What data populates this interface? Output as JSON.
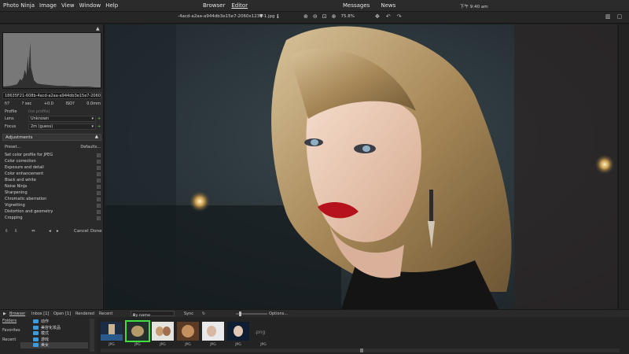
{
  "menubar": {
    "app_name": "Photo Ninja",
    "menus": [
      "Image",
      "View",
      "Window",
      "Help"
    ],
    "mode_browser": "Browser",
    "mode_editor": "Editor",
    "messages": "Messages",
    "news": "News",
    "clock": "下午 9:40 am"
  },
  "toolbar": {
    "filename": "-4acd-a2aa-a944db3e15e7-2060x1236-1.jpg",
    "zoom_pct": "75.8%"
  },
  "left": {
    "filename_full": "18635F21-608b-4acd-a2aa-a944db3e15e7-2060x...",
    "meta": {
      "aperture": "f/?",
      "shutter": "? sec",
      "ev": "+0.0",
      "iso": "ISO?",
      "focal": "0.0mm"
    },
    "profile_label": "Profile",
    "profile_value": "(no profile)",
    "lens_label": "Lens",
    "lens_value": "Unknown",
    "focus_label": "Focus",
    "focus_value": "2m (guess)",
    "adjustments_title": "Adjustments",
    "preset_label": "Preset...",
    "defaults_label": "Defaults...",
    "adjustments": [
      "Set color profile for JPEG",
      "Color correction",
      "Exposure and detail",
      "Color enhancement",
      "Black and white",
      "Noise Ninja",
      "Sharpening",
      "Chromatic aberration",
      "Vignetting",
      "Distortion and geometry",
      "Cropping"
    ],
    "cancel": "Cancel",
    "done": "Done"
  },
  "browserbar": {
    "browser": "Browser",
    "inbox": "Inbox [1]",
    "open": "Open [1]",
    "rendered": "Rendered",
    "recent": "Recent",
    "sort": "By name",
    "sync": "Sync",
    "options": "Options..."
  },
  "filmleft": {
    "folders": "Folders",
    "favorites": "Favorites",
    "recent": "Recent",
    "tree": [
      "动作",
      "美容化妆品",
      "模式",
      "游戏",
      "美女"
    ]
  },
  "filmstrip": {
    "thumbs": [
      {
        "label": "JPG",
        "selected": false
      },
      {
        "label": "JPG",
        "selected": true
      },
      {
        "label": "JPG",
        "selected": false
      },
      {
        "label": "JPG",
        "selected": false
      },
      {
        "label": "JPG",
        "selected": false
      },
      {
        "label": "JPG",
        "selected": false
      },
      {
        "label": "JPG",
        "selected": false
      }
    ],
    "placeholder": ".png"
  },
  "colors": {
    "accent_green": "#3ee03e",
    "folder_blue": "#3b9be0"
  }
}
